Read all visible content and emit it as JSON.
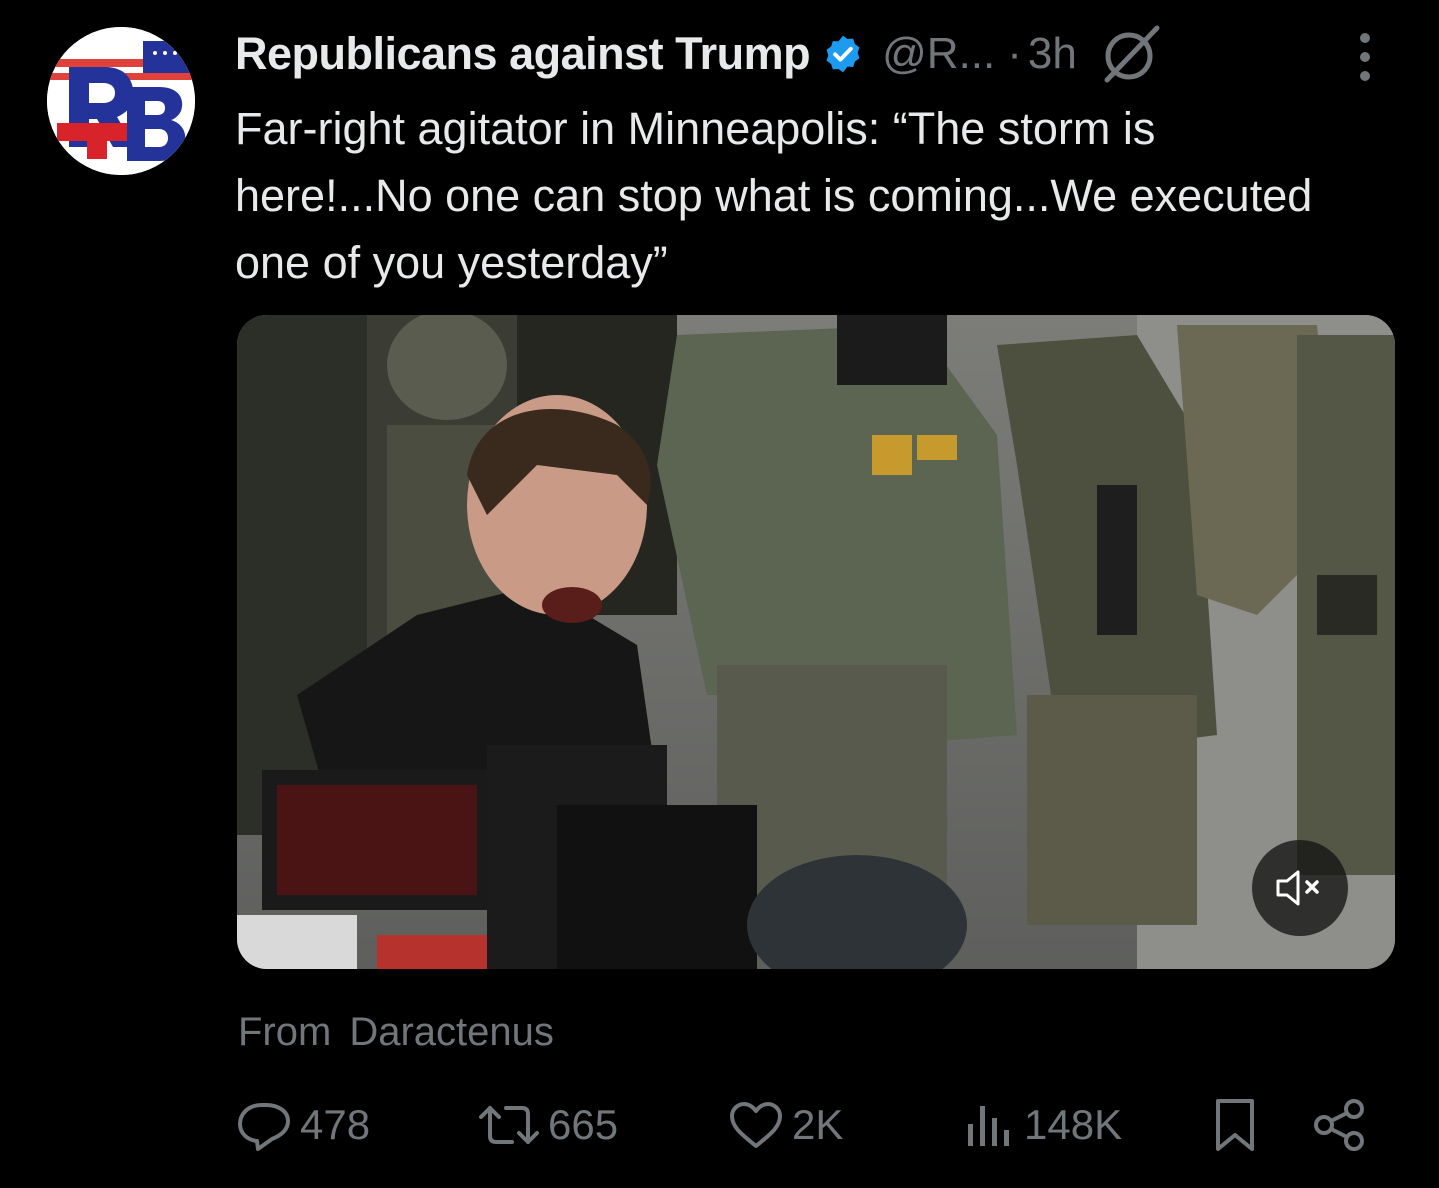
{
  "tweet": {
    "author": {
      "display_name": "Republicans against Trump",
      "handle": "@R...",
      "verified": true,
      "avatar_letters": "RB"
    },
    "separator": "·",
    "time": "3h",
    "text": "Far-right agitator in Minneapolis: “The storm is here!...No one can stop what is coming...We executed one of you yesterday”",
    "attribution": {
      "prefix": "From",
      "source": "Daractenus"
    },
    "stats": {
      "replies": "478",
      "reposts": "665",
      "likes": "2K",
      "views": "148K"
    }
  },
  "colors": {
    "background": "#000000",
    "text_primary": "#e7e9ea",
    "text_secondary": "#71767b",
    "verified_blue": "#1d9bf0"
  },
  "icons": {
    "verified": "verified-badge-icon",
    "grok": "grok-icon",
    "more": "more-vertical-icon",
    "mute": "speaker-muted-icon",
    "reply": "reply-bubble-icon",
    "repost": "repost-icon",
    "like": "heart-icon",
    "views": "views-bar-chart-icon",
    "bookmark": "bookmark-icon",
    "share": "share-icon"
  }
}
